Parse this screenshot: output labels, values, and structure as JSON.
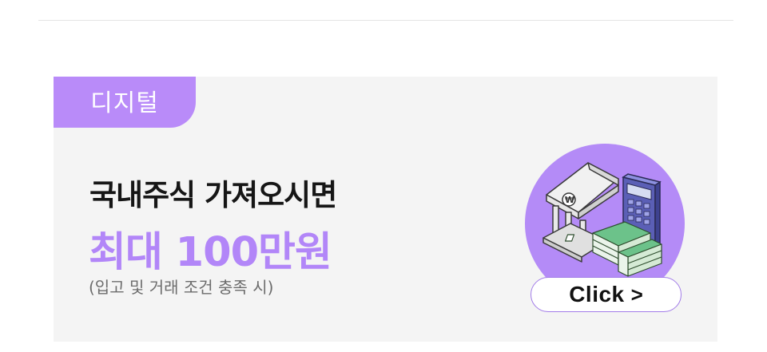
{
  "banner": {
    "badge": "디지털",
    "headline": "국내주식 가져오시면",
    "subheadline": "최대 100만원",
    "note": "(입고 및 거래 조건 충족 시)",
    "cta_label": "Click",
    "cta_icon": "chevron-right-icon",
    "illustration_icon": "bank-money-calculator-icon",
    "colors": {
      "accent": "#b98bf9",
      "accent_text": "#b286f8",
      "background": "#f4f4f4"
    }
  }
}
